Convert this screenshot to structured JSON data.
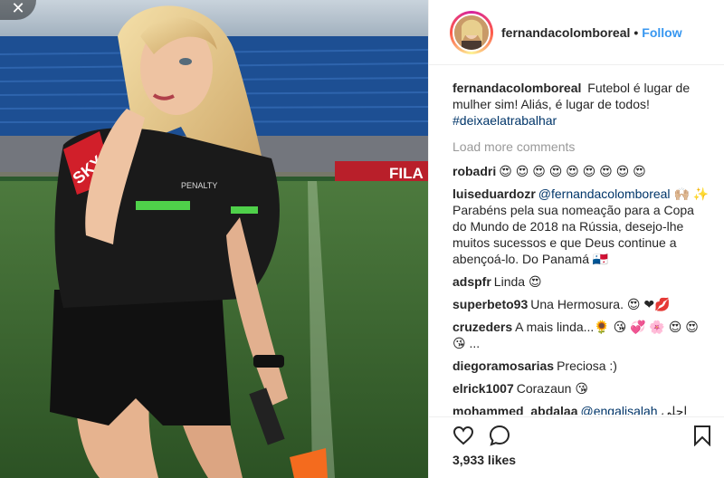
{
  "post": {
    "username": "fernandacolomboreal",
    "follow_label": "Follow",
    "separator": "•"
  },
  "caption": {
    "username": "fernandacolomboreal",
    "text": "Futebol é lugar de mulher sim! Aliás, é lugar de todos!",
    "hashtag": "#deixaelatrabalhar"
  },
  "load_more_label": "Load more comments",
  "comments": [
    {
      "user": "robadri",
      "text": "😍 😍 😍 😍 😍 😍 😍 😍 😍",
      "mention": "",
      "after": ""
    },
    {
      "user": "luiseduardozr",
      "text": "",
      "mention": "@fernandacolomboreal",
      "after": "🙌🏼 ✨  Parabéns pela sua nomeação para a Copa do Mundo de 2018 na Rússia, desejo-lhe muitos sucessos e que Deus continue a abençoá-lo. Do Panamá 🇵🇦"
    },
    {
      "user": "adspfr",
      "text": "Linda 😍",
      "mention": "",
      "after": ""
    },
    {
      "user": "superbeto93",
      "text": "Una Hermosura. 😍 ❤💋",
      "mention": "",
      "after": ""
    },
    {
      "user": "cruzeders",
      "text": "A mais linda...🌻 😘 💞 🌸 😍 😍 😘 ...",
      "mention": "",
      "after": ""
    },
    {
      "user": "diegoramosarias",
      "text": "Preciosa :)",
      "mention": "",
      "after": ""
    },
    {
      "user": "elrick1007",
      "text": "Corazaun 😘",
      "mention": "",
      "after": ""
    },
    {
      "user": "mohammed_abdalaa",
      "text": "",
      "mention": "@engalisalah",
      "after": "احلى"
    }
  ],
  "actions": {
    "like_icon": "heart-icon",
    "comment_icon": "comment-icon",
    "save_icon": "bookmark-icon"
  },
  "likes_label": "3,933 likes",
  "photo": {
    "close_glyph": "✕",
    "shirt_sponsor": "SKY",
    "shirt_brand": "PENALTY",
    "board_text": "FILA"
  },
  "colors": {
    "follow": "#3897f0",
    "link": "#003569",
    "muted": "#999999"
  }
}
